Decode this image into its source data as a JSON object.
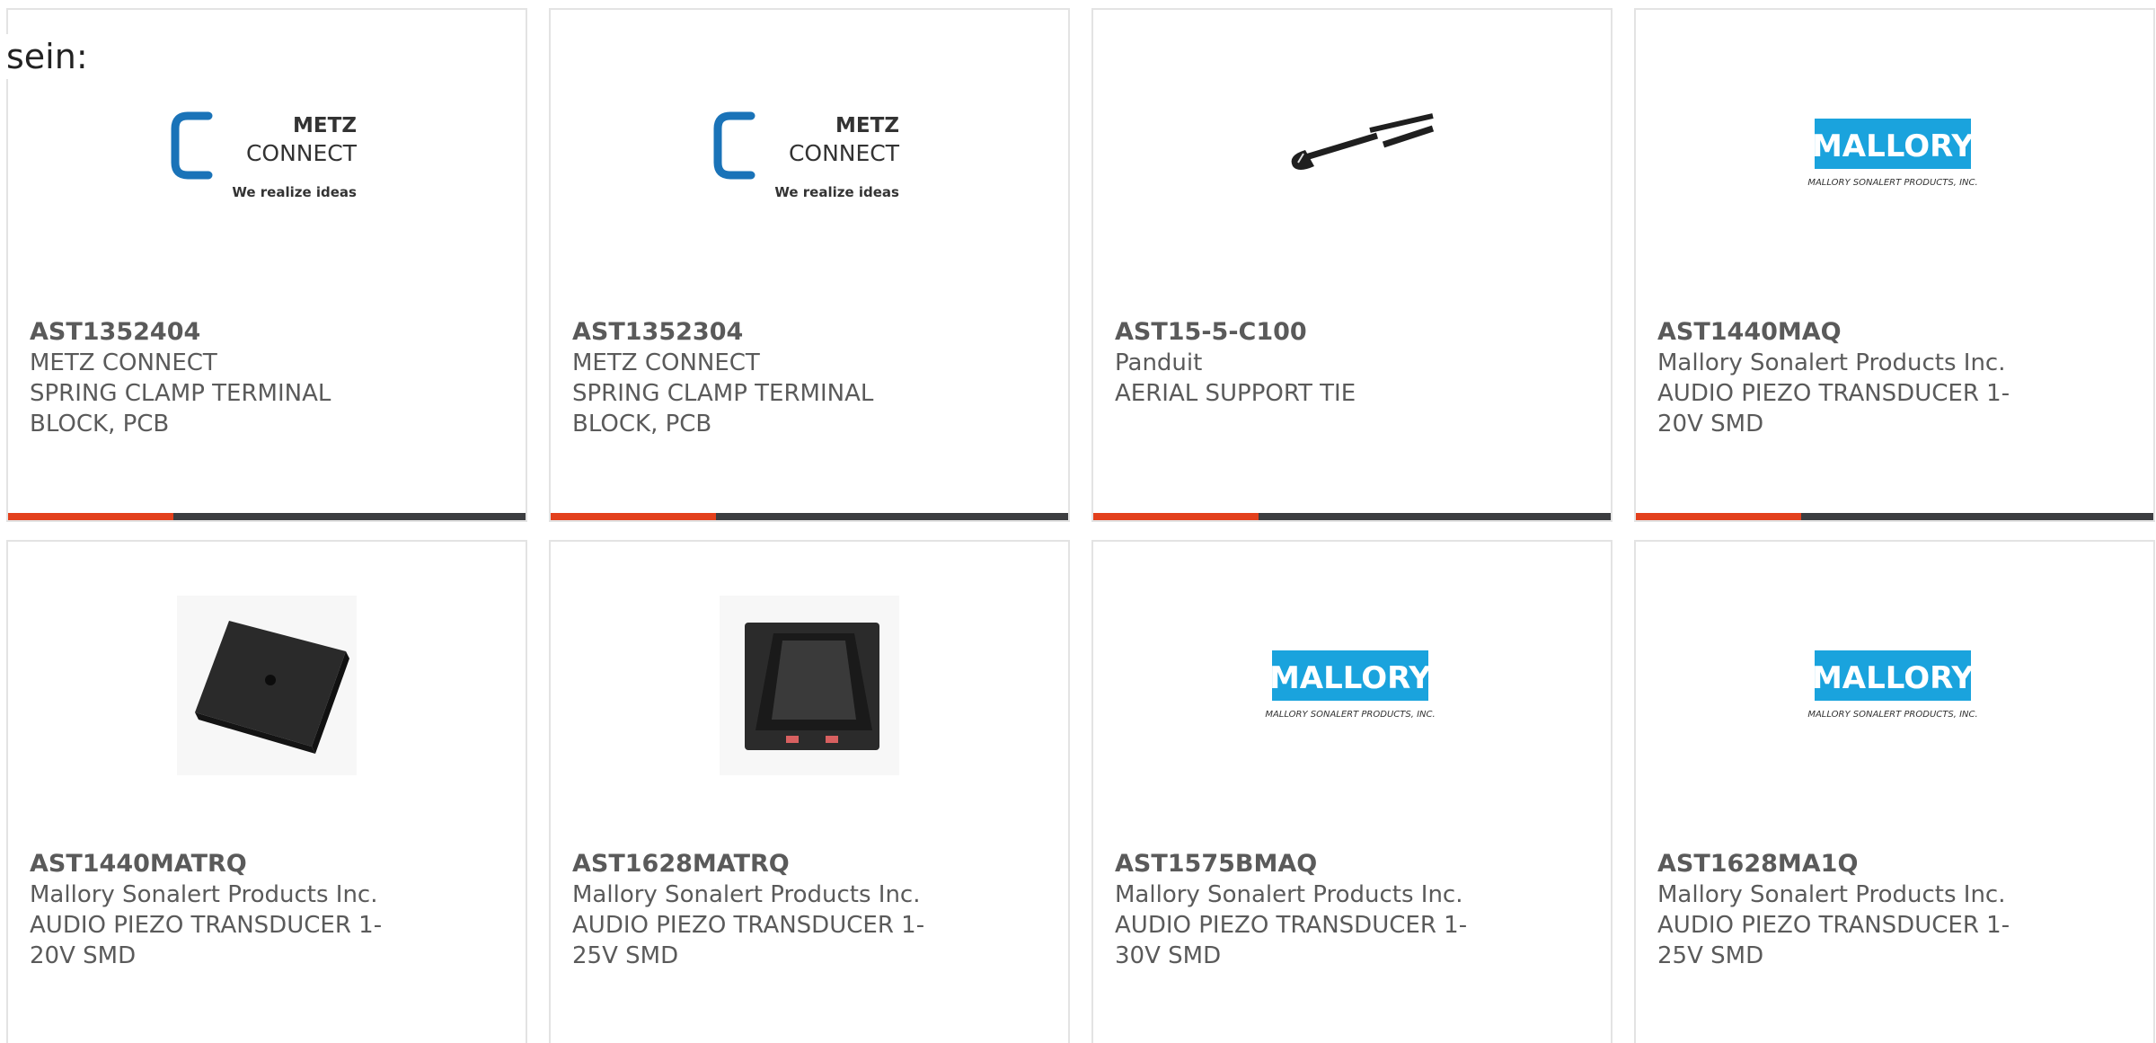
{
  "overlay_text": "sein:",
  "colors": {
    "accent_bar": "#e3401c",
    "bar_track": "#3c3d40",
    "metz_blue": "#1a73b8",
    "mallory_blue": "#1aa3dd"
  },
  "products": [
    {
      "part_number": "AST1352404",
      "manufacturer": "METZ CONNECT",
      "description": "SPRING CLAMP TERMINAL BLOCK, PCB",
      "image": "metz-connect-logo",
      "logo": {
        "line1": "METZ",
        "line2": "CONNECT",
        "tagline": "We realize ideas"
      },
      "progress": 0.32
    },
    {
      "part_number": "AST1352304",
      "manufacturer": "METZ CONNECT",
      "description": "SPRING CLAMP TERMINAL BLOCK, PCB",
      "image": "metz-connect-logo",
      "logo": {
        "line1": "METZ",
        "line2": "CONNECT",
        "tagline": "We realize ideas"
      },
      "progress": 0.32
    },
    {
      "part_number": "AST15-5-C100",
      "manufacturer": "Panduit",
      "description": "AERIAL SUPPORT TIE",
      "image": "cable-tie-photo",
      "progress": 0.32
    },
    {
      "part_number": "AST1440MAQ",
      "manufacturer": "Mallory Sonalert Products Inc.",
      "description": "AUDIO PIEZO TRANSDUCER 1-20V SMD",
      "image": "mallory-logo",
      "logo": {
        "line1": "MALLORY",
        "tagline": "MALLORY SONALERT PRODUCTS, INC."
      },
      "progress": 0.32
    },
    {
      "part_number": "AST1440MATRQ",
      "manufacturer": "Mallory Sonalert Products Inc.",
      "description": "AUDIO PIEZO TRANSDUCER 1-20V SMD",
      "image": "piezo-buzzer-photo"
    },
    {
      "part_number": "AST1628MATRQ",
      "manufacturer": "Mallory Sonalert Products Inc.",
      "description": "AUDIO PIEZO TRANSDUCER 1-25V SMD",
      "image": "piezo-transducer-photo"
    },
    {
      "part_number": "AST1575BMAQ",
      "manufacturer": "Mallory Sonalert Products Inc.",
      "description": "AUDIO PIEZO TRANSDUCER 1-30V SMD",
      "image": "mallory-logo",
      "logo": {
        "line1": "MALLORY",
        "tagline": "MALLORY SONALERT PRODUCTS, INC."
      }
    },
    {
      "part_number": "AST1628MA1Q",
      "manufacturer": "Mallory Sonalert Products Inc.",
      "description": "AUDIO PIEZO TRANSDUCER 1-25V SMD",
      "image": "mallory-logo",
      "logo": {
        "line1": "MALLORY",
        "tagline": "MALLORY SONALERT PRODUCTS, INC."
      }
    }
  ]
}
